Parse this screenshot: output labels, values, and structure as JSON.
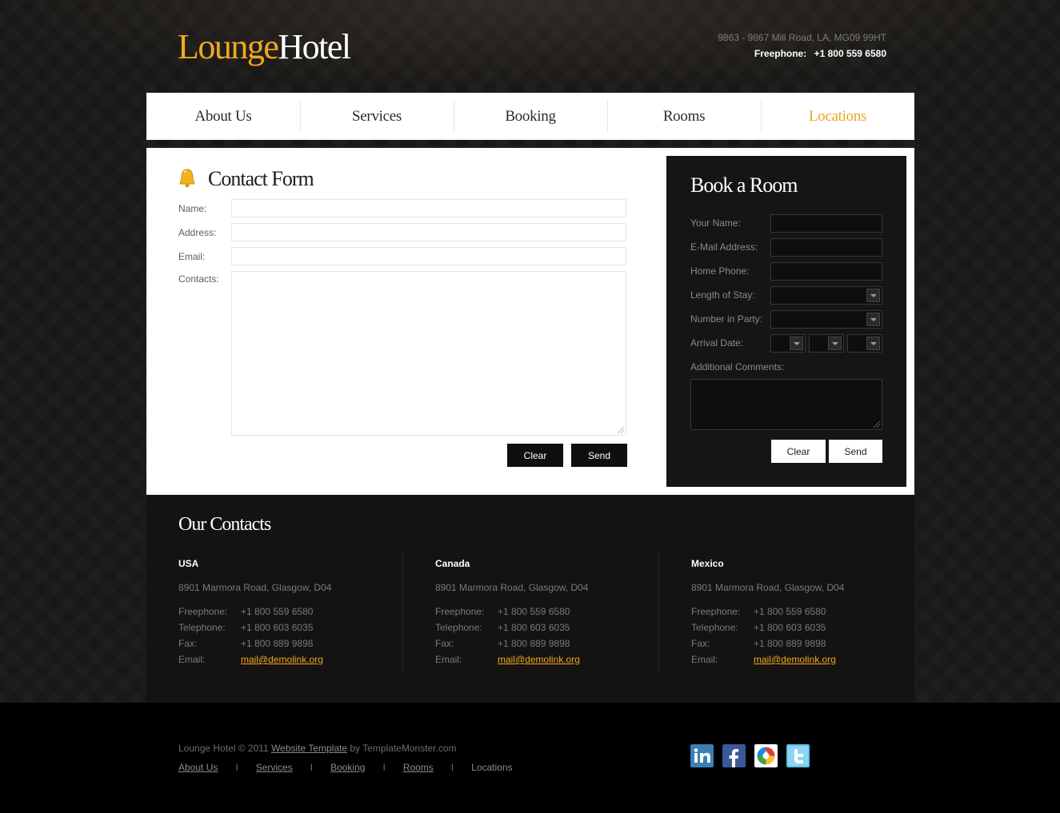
{
  "header": {
    "logo_part1": "Lounge",
    "logo_part2": "Hotel",
    "address": "9863 - 9867 Mill Road, LA, MG09 99HT",
    "freephone_label": "Freephone:",
    "freephone_number": "+1 800 559 6580"
  },
  "nav": {
    "items": [
      {
        "label": "About Us"
      },
      {
        "label": "Services"
      },
      {
        "label": "Booking"
      },
      {
        "label": "Rooms"
      },
      {
        "label": "Locations"
      }
    ],
    "active": "Locations"
  },
  "contact_form": {
    "title": "Contact Form",
    "name_label": "Name:",
    "name_value": "",
    "address_label": "Address:",
    "address_value": "",
    "email_label": "Email:",
    "email_value": "",
    "contacts_label": "Contacts:",
    "contacts_value": "",
    "clear_label": "Clear",
    "send_label": "Send"
  },
  "book_room": {
    "title": "Book a Room",
    "your_name_label": "Your Name:",
    "email_label": "E-Mail Address:",
    "home_phone_label": "Home Phone:",
    "length_of_stay_label": "Length of Stay:",
    "number_in_party_label": "Number in Party:",
    "arrival_date_label": "Arrival Date:",
    "additional_comments_label": "Additional Comments:",
    "clear_label": "Clear",
    "send_label": "Send"
  },
  "contacts": {
    "title": "Our Contacts",
    "offices": [
      {
        "name": "USA",
        "address": "8901 Marmora Road, Glasgow, D04",
        "freephone_label": "Freephone:",
        "freephone": "+1 800 559 6580",
        "telephone_label": "Telephone:",
        "telephone": "+1 800 603 6035",
        "fax_label": "Fax:",
        "fax": "+1 800 889 9898",
        "email_label": "Email:",
        "email": "mail@demolink.org"
      },
      {
        "name": "Canada",
        "address": "8901 Marmora Road, Glasgow, D04",
        "freephone_label": "Freephone:",
        "freephone": "+1 800 559 6580",
        "telephone_label": "Telephone:",
        "telephone": "+1 800 603 6035",
        "fax_label": "Fax:",
        "fax": "+1 800 889 9898",
        "email_label": "Email:",
        "email": "mail@demolink.org"
      },
      {
        "name": "Mexico",
        "address": "8901 Marmora Road, Glasgow, D04",
        "freephone_label": "Freephone:",
        "freephone": "+1 800 559 6580",
        "telephone_label": "Telephone:",
        "telephone": "+1 800 603 6035",
        "fax_label": "Fax:",
        "fax": "+1 800 889 9898",
        "email_label": "Email:",
        "email": "mail@demolink.org"
      }
    ]
  },
  "footer": {
    "copyright_prefix": "Lounge Hotel © 2011",
    "copyright_link": "Website Template",
    "copyright_suffix": "by TemplateMonster.com",
    "links": [
      "About Us",
      "Services",
      "Booking",
      "Rooms",
      "Locations"
    ],
    "separator": "I",
    "social": [
      "linkedin-icon",
      "facebook-icon",
      "picasa-icon",
      "twitter-icon"
    ]
  },
  "colors": {
    "accent": "#f0a81e",
    "page_bg": "#1b1917",
    "panel_dark": "#161513",
    "footer_bg": "#000000"
  }
}
